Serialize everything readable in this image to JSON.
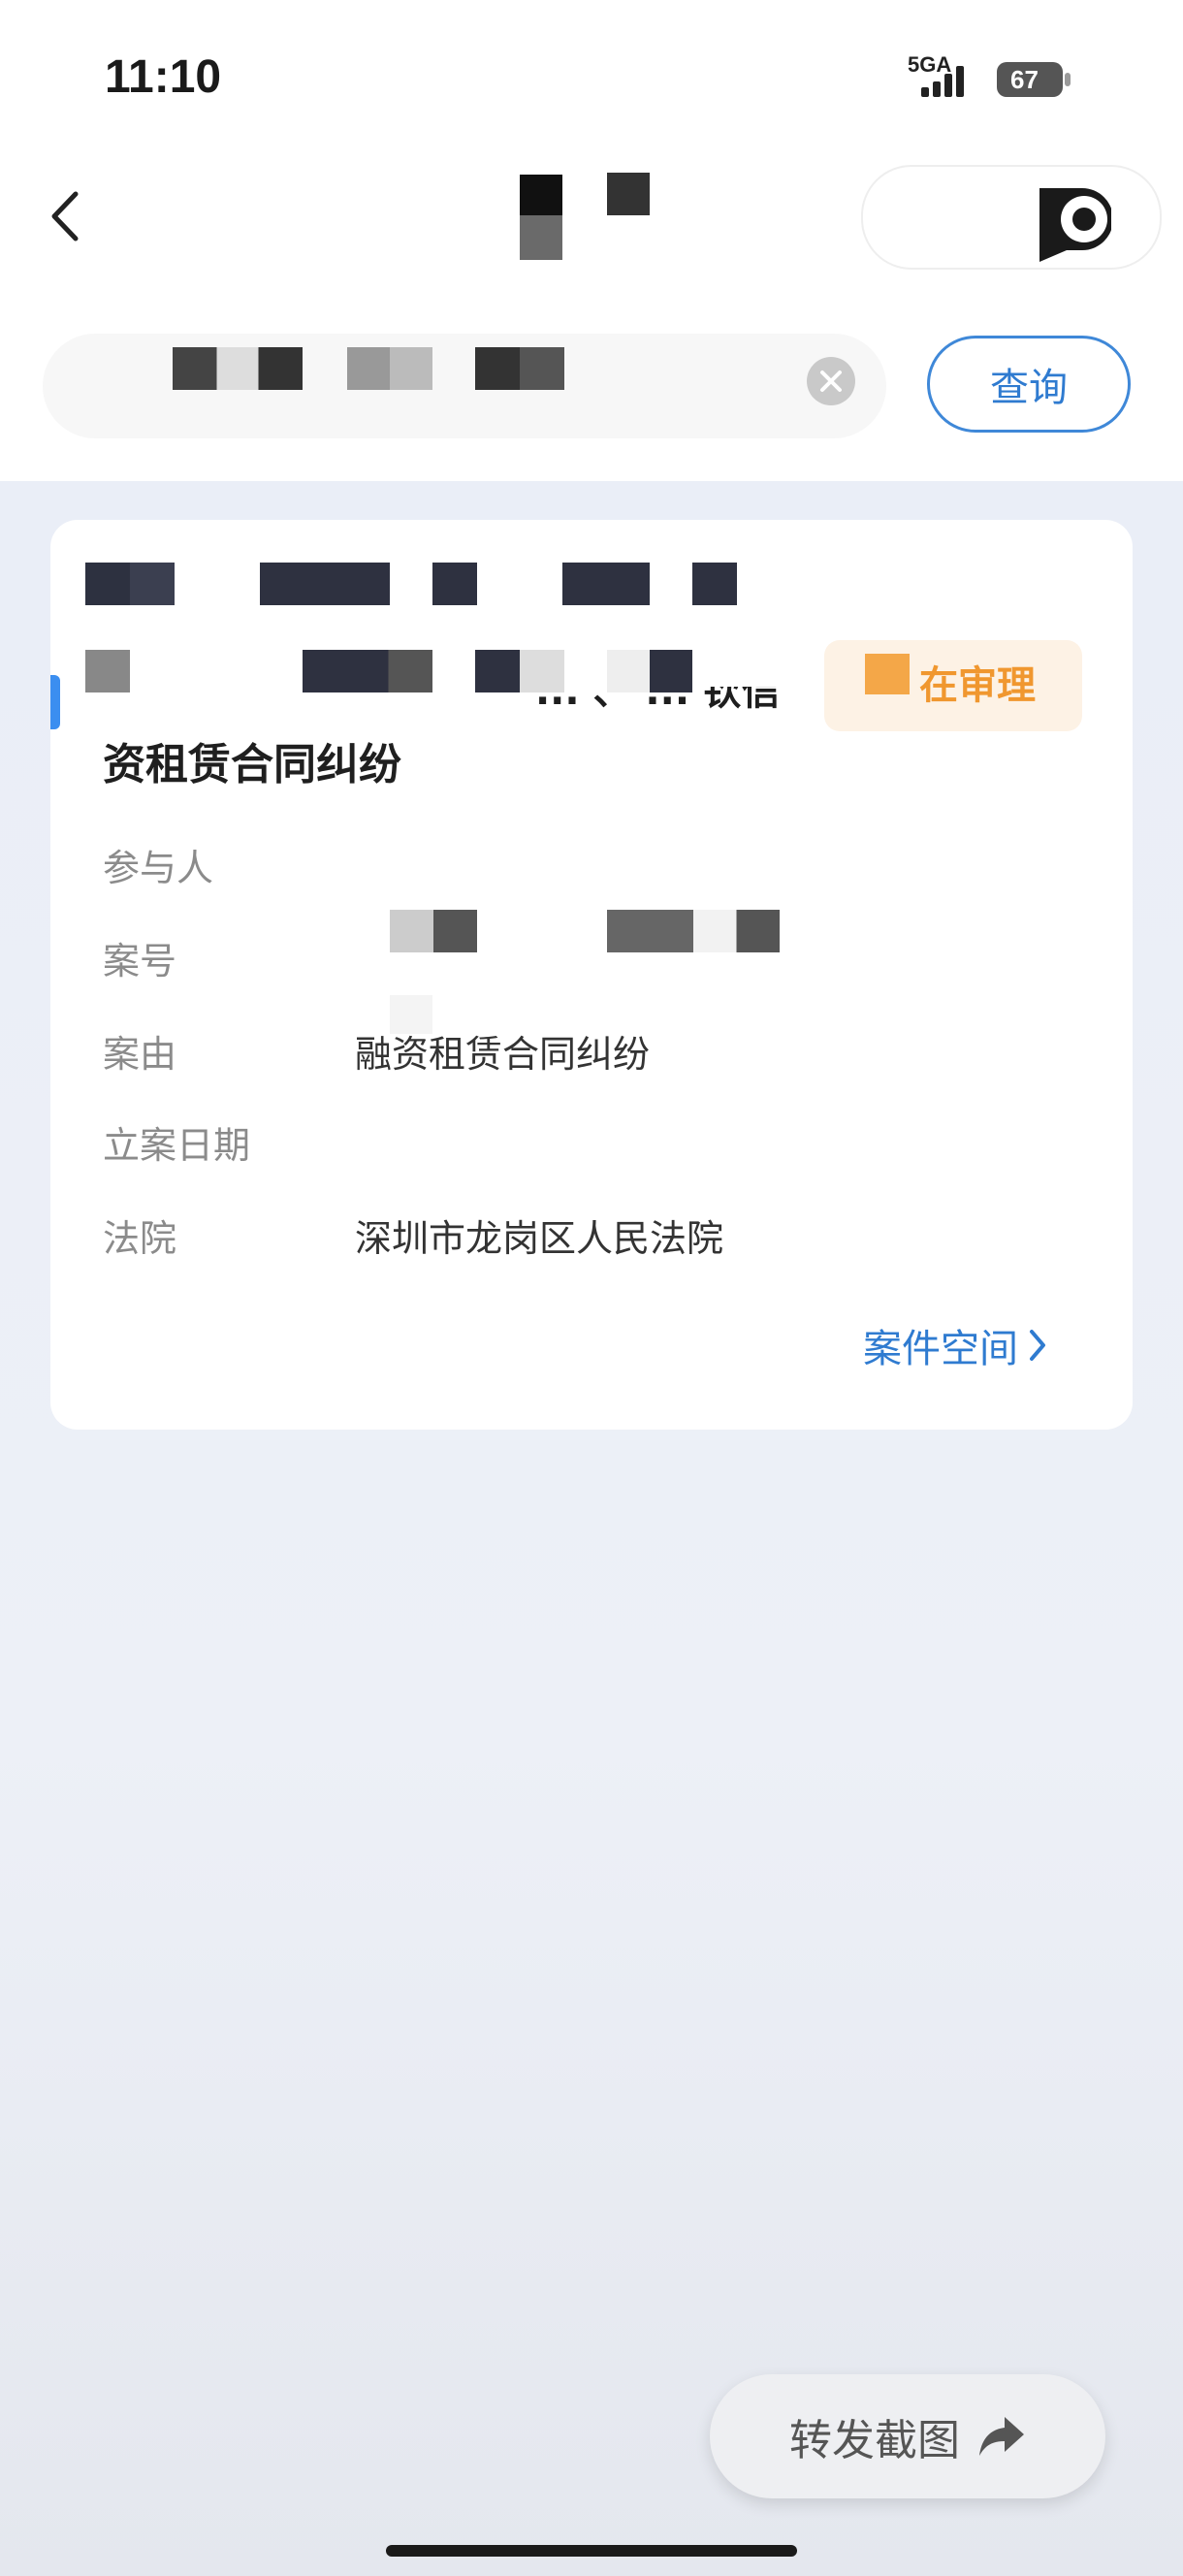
{
  "status_bar": {
    "time": "11:10",
    "network": "5GA",
    "battery": "67"
  },
  "search": {
    "query_label": "查询"
  },
  "case_card": {
    "partial_parties_text": " ... 、 ... 钦信",
    "status_badge": "在审理",
    "title": "资租赁合同纠纷",
    "fields": [
      {
        "label": "参与人",
        "value": ""
      },
      {
        "label": "案号",
        "value": ""
      },
      {
        "label": "案由",
        "value": "融资租赁合同纠纷"
      },
      {
        "label": "立案日期",
        "value": ""
      },
      {
        "label": "法院",
        "value": "深圳市龙岗区人民法院"
      }
    ],
    "space_link": "案件空间"
  },
  "bottom": {
    "share_label": "转发截图"
  },
  "colors": {
    "accent": "#2f7bd0",
    "status": "#f0972f",
    "background": "#eaeef7"
  }
}
